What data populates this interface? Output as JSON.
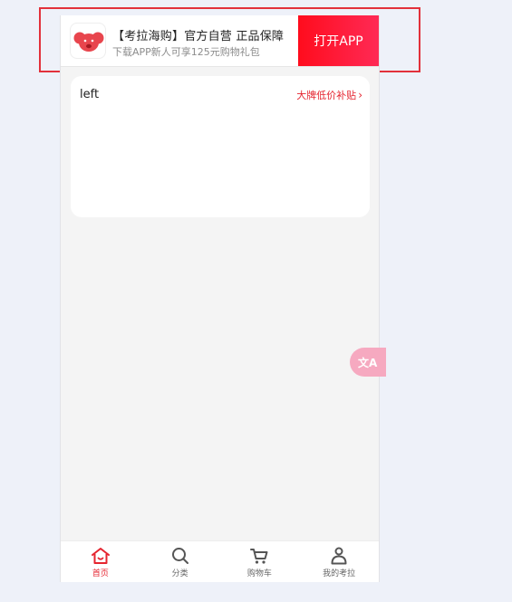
{
  "banner": {
    "title": "【考拉海购】官方自营 正品保障",
    "subtitle": "下载APP新人可享125元购物礼包",
    "open_button": "打开APP",
    "logo_icon": "koala-logo-icon"
  },
  "card": {
    "left_label": "left",
    "link_text": "大牌低价补贴",
    "link_chevron": "›"
  },
  "fab": {
    "label": "文A",
    "icon": "translate-icon"
  },
  "tabbar": {
    "items": [
      {
        "label": "首页",
        "icon": "home-icon",
        "active": true
      },
      {
        "label": "分类",
        "icon": "search-icon",
        "active": false
      },
      {
        "label": "购物车",
        "icon": "cart-icon",
        "active": false
      },
      {
        "label": "我的考拉",
        "icon": "user-icon",
        "active": false
      }
    ]
  },
  "colors": {
    "accent": "#e5242f",
    "open_button_start": "#ff0c1d",
    "open_button_end": "#ff2a55",
    "highlight_frame": "#e2313b",
    "fab": "#f6a9c0"
  }
}
